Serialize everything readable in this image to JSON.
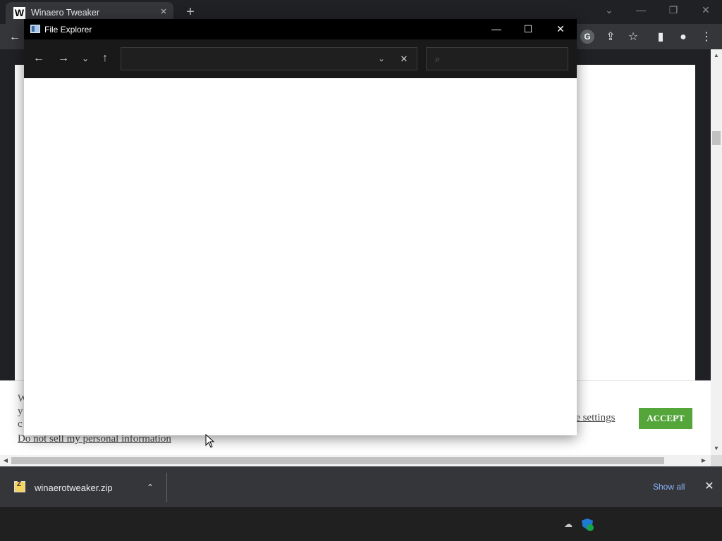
{
  "browser": {
    "tab": {
      "title": "Winaero Tweaker",
      "favicon": "W"
    },
    "tab_close": "×",
    "new_tab": "+",
    "window_controls": {
      "tab_search": "⌄",
      "minimize": "—",
      "restore": "❐",
      "close": "✕"
    },
    "toolbar": {
      "back": "←",
      "google_icon": "G",
      "share_icon": "⇪",
      "bookmark_icon": "☆",
      "sidepanel_icon": "▮",
      "profile_icon": "●",
      "menu_icon": "⋮"
    }
  },
  "webpage": {
    "cookie_bar": {
      "text_fragment": "W\ny\nc",
      "do_not_sell": "Do not sell my personal information",
      "settings_link": "ie settings",
      "accept": "ACCEPT"
    },
    "scroll": {
      "up": "▲",
      "down": "▼",
      "left": "◀",
      "right": "▶"
    }
  },
  "downloads": {
    "filename": "winaerotweaker.zip",
    "chevron": "⌃",
    "show_all": "Show all",
    "close": "✕"
  },
  "taskbar": {
    "onedrive_icon": "☁",
    "defender_icon": "shield-icon"
  },
  "explorer": {
    "title": "File Explorer",
    "controls": {
      "minimize": "—",
      "maximize": "☐",
      "close": "✕"
    },
    "nav": {
      "back": "←",
      "forward": "→",
      "recent": "⌄",
      "up": "↑"
    },
    "address": {
      "value": "",
      "dropdown": "⌄",
      "clear": "✕"
    },
    "search": {
      "icon": "⌕",
      "placeholder": ""
    }
  },
  "colors": {
    "accept_button": "#54a63b",
    "show_all_link": "#8ab4f8",
    "explorer_titlebar": "#000000",
    "explorer_toolbar": "#191919"
  }
}
